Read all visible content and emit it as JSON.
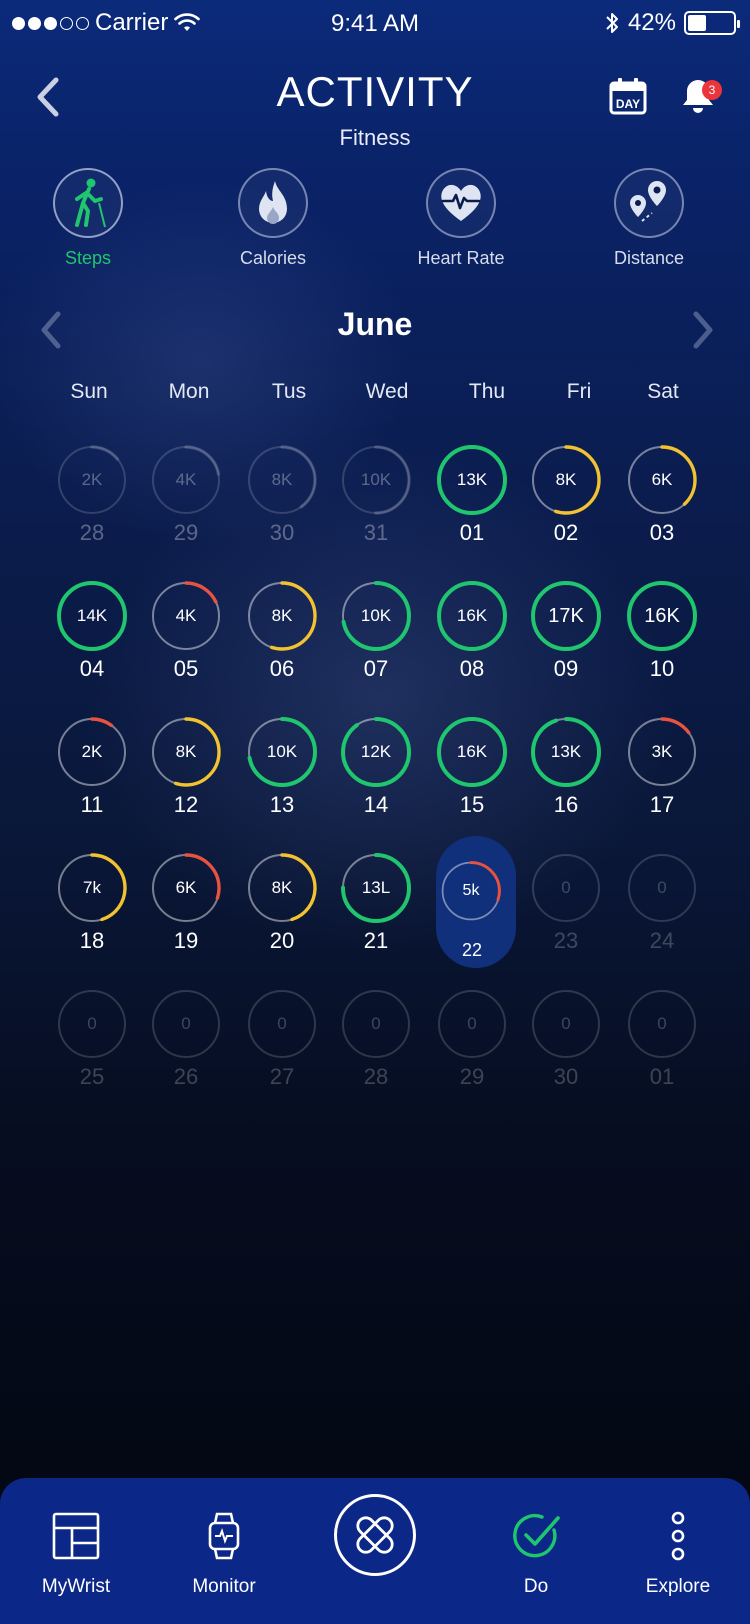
{
  "status_bar": {
    "carrier": "Carrier",
    "time": "9:41 AM",
    "battery": "42%",
    "battery_level": 0.42,
    "signal_bars_filled": 3,
    "signal_bars_total": 5
  },
  "header": {
    "title": "ACTIVITY",
    "subtitle": "Fitness",
    "day_button_label": "DAY",
    "notification_count": "3"
  },
  "metric_tabs": [
    {
      "label": "Steps",
      "icon": "walking-icon",
      "active": true
    },
    {
      "label": "Calories",
      "icon": "flame-icon",
      "active": false
    },
    {
      "label": "Heart Rate",
      "icon": "heart-rate-icon",
      "active": false
    },
    {
      "label": "Distance",
      "icon": "map-pin-icon",
      "active": false
    }
  ],
  "calendar": {
    "month": "June",
    "weekdays": [
      "Sun",
      "Mon",
      "Tus",
      "Wed",
      "Thu",
      "Fri",
      "Sat"
    ],
    "goal_colors": {
      "met": "#1fc66e",
      "partial": "#f2c230",
      "low": "#e8533f",
      "track": "rgba(255,255,255,0.45)",
      "track_dim": "rgba(255,255,255,0.16)"
    },
    "weeks": [
      [
        {
          "value": "2K",
          "date": "28",
          "state": "dim",
          "progress": 0.14,
          "color": "track_dim"
        },
        {
          "value": "4K",
          "date": "29",
          "state": "dim",
          "progress": 0.22,
          "color": "track_dim"
        },
        {
          "value": "8K",
          "date": "30",
          "state": "dim",
          "progress": 0.4,
          "color": "track_dim"
        },
        {
          "value": "10K",
          "date": "31",
          "state": "dim",
          "progress": 0.5,
          "color": "track_dim"
        },
        {
          "value": "13K",
          "date": "01",
          "state": "normal",
          "progress": 1,
          "color": "met"
        },
        {
          "value": "8K",
          "date": "02",
          "state": "normal",
          "progress": 0.55,
          "color": "partial"
        },
        {
          "value": "6K",
          "date": "03",
          "state": "normal",
          "progress": 0.38,
          "color": "partial"
        }
      ],
      [
        {
          "value": "14K",
          "date": "04",
          "state": "normal",
          "progress": 1,
          "color": "met"
        },
        {
          "value": "4K",
          "date": "05",
          "state": "normal",
          "progress": 0.18,
          "color": "low"
        },
        {
          "value": "8K",
          "date": "06",
          "state": "normal",
          "progress": 0.55,
          "color": "partial"
        },
        {
          "value": "10K",
          "date": "07",
          "state": "normal",
          "progress": 0.72,
          "color": "met"
        },
        {
          "value": "16K",
          "date": "08",
          "state": "normal",
          "progress": 1,
          "color": "met"
        },
        {
          "value": "17K",
          "date": "09",
          "state": "big",
          "progress": 1,
          "color": "met"
        },
        {
          "value": "16K",
          "date": "10",
          "state": "big",
          "progress": 1,
          "color": "met"
        }
      ],
      [
        {
          "value": "2K",
          "date": "11",
          "state": "normal",
          "progress": 0.1,
          "color": "low"
        },
        {
          "value": "8K",
          "date": "12",
          "state": "normal",
          "progress": 0.55,
          "color": "partial"
        },
        {
          "value": "10K",
          "date": "13",
          "state": "normal",
          "progress": 0.72,
          "color": "met"
        },
        {
          "value": "12K",
          "date": "14",
          "state": "normal",
          "progress": 0.9,
          "color": "met"
        },
        {
          "value": "16K",
          "date": "15",
          "state": "normal",
          "progress": 1,
          "color": "met"
        },
        {
          "value": "13K",
          "date": "16",
          "state": "normal",
          "progress": 0.95,
          "color": "met"
        },
        {
          "value": "3K",
          "date": "17",
          "state": "normal",
          "progress": 0.15,
          "color": "low"
        }
      ],
      [
        {
          "value": "7k",
          "date": "18",
          "state": "normal",
          "progress": 0.45,
          "color": "partial"
        },
        {
          "value": "6K",
          "date": "19",
          "state": "normal",
          "progress": 0.3,
          "color": "low"
        },
        {
          "value": "8K",
          "date": "20",
          "state": "normal",
          "progress": 0.45,
          "color": "partial"
        },
        {
          "value": "13L",
          "date": "21",
          "state": "normal",
          "progress": 0.75,
          "color": "met"
        },
        {
          "value": "5k",
          "date": "22",
          "state": "today",
          "progress": 0.3,
          "color": "low"
        },
        {
          "value": "0",
          "date": "23",
          "state": "future",
          "progress": 0,
          "color": "track_dim"
        },
        {
          "value": "0",
          "date": "24",
          "state": "future",
          "progress": 0,
          "color": "track_dim"
        }
      ],
      [
        {
          "value": "0",
          "date": "25",
          "state": "future",
          "progress": 0,
          "color": "track_dim"
        },
        {
          "value": "0",
          "date": "26",
          "state": "future",
          "progress": 0,
          "color": "track_dim"
        },
        {
          "value": "0",
          "date": "27",
          "state": "future",
          "progress": 0,
          "color": "track_dim"
        },
        {
          "value": "0",
          "date": "28",
          "state": "future",
          "progress": 0,
          "color": "track_dim"
        },
        {
          "value": "0",
          "date": "29",
          "state": "future",
          "progress": 0,
          "color": "track_dim"
        },
        {
          "value": "0",
          "date": "30",
          "state": "future",
          "progress": 0,
          "color": "track_dim"
        },
        {
          "value": "0",
          "date": "01",
          "state": "future",
          "progress": 0,
          "color": "track_dim"
        }
      ]
    ]
  },
  "bottom_nav": [
    {
      "label": "MyWrist",
      "icon": "dashboard-icon",
      "active": false
    },
    {
      "label": "Monitor",
      "icon": "watch-icon",
      "active": false
    },
    {
      "label": "",
      "icon": "app-logo-icon",
      "active": false
    },
    {
      "label": "Do",
      "icon": "check-circle-icon",
      "active": true
    },
    {
      "label": "Explore",
      "icon": "more-vertical-icon",
      "active": false
    }
  ],
  "colors": {
    "accent_green": "#1fc66e",
    "nav_bg": "#0b2788",
    "today_bg": "#11307c",
    "badge_red": "#e9353b"
  }
}
